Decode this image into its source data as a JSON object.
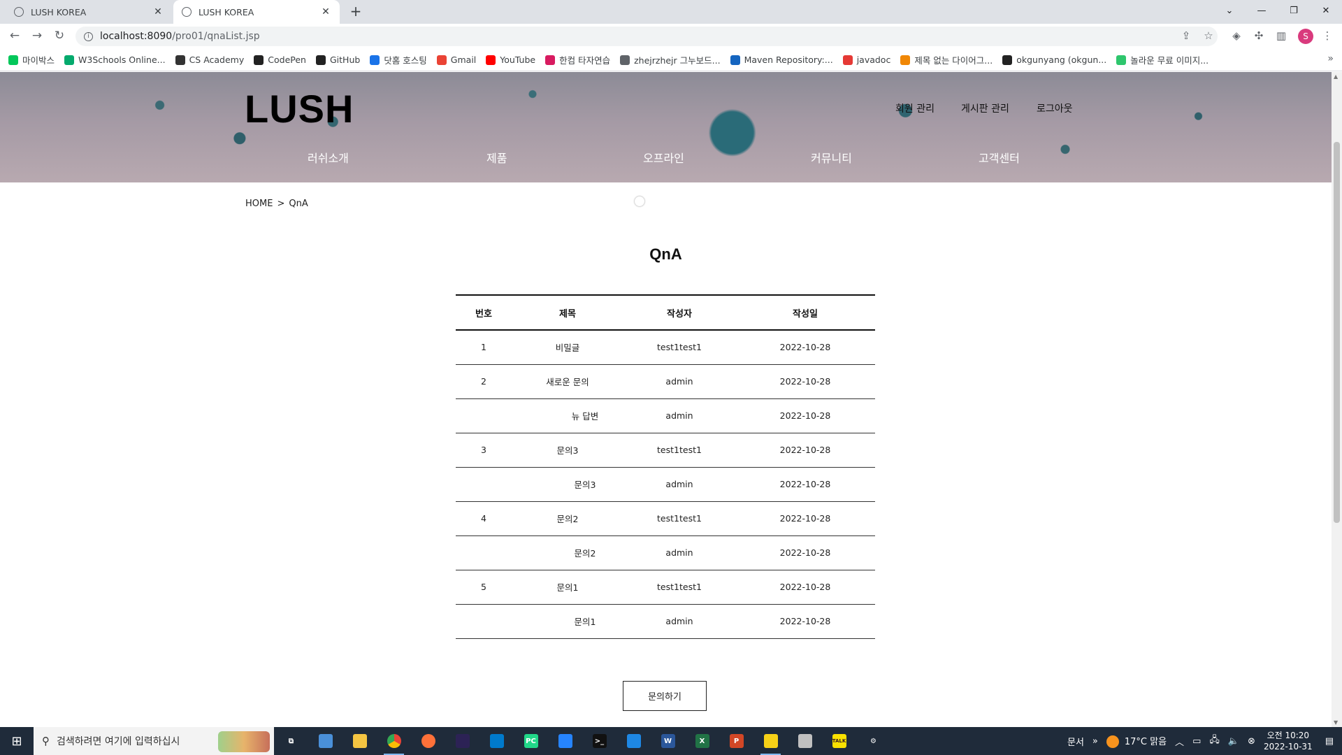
{
  "browser": {
    "tabs": [
      {
        "title": "LUSH KOREA",
        "active": false
      },
      {
        "title": "LUSH KOREA",
        "active": true
      }
    ],
    "url_host": "localhost:8090",
    "url_path": "/pro01/qnaList.jsp",
    "bookmarks": [
      {
        "label": "마이박스",
        "icon": "naver-icon",
        "color": "#03c75a"
      },
      {
        "label": "W3Schools Online...",
        "icon": "w3schools-icon",
        "color": "#04aa6d"
      },
      {
        "label": "CS Academy",
        "icon": "cs-academy-icon",
        "color": "#333333"
      },
      {
        "label": "CodePen",
        "icon": "codepen-icon",
        "color": "#222222"
      },
      {
        "label": "GitHub",
        "icon": "github-icon",
        "color": "#222222"
      },
      {
        "label": "닷홈 호스팅",
        "icon": "dothome-icon",
        "color": "#1a73e8"
      },
      {
        "label": "Gmail",
        "icon": "gmail-icon",
        "color": "#ea4335"
      },
      {
        "label": "YouTube",
        "icon": "youtube-icon",
        "color": "#ff0000"
      },
      {
        "label": "한컴 타자연습",
        "icon": "hancom-icon",
        "color": "#d81b60"
      },
      {
        "label": "zhejrzhejr 그누보드...",
        "icon": "globe-icon",
        "color": "#5f6368"
      },
      {
        "label": "Maven Repository:...",
        "icon": "maven-icon",
        "color": "#1565c0"
      },
      {
        "label": "javadoc",
        "icon": "oracle-icon",
        "color": "#e53935"
      },
      {
        "label": "제목 없는 다이어그...",
        "icon": "drawio-icon",
        "color": "#f08705"
      },
      {
        "label": "okgunyang (okgun...",
        "icon": "github-icon",
        "color": "#222222"
      },
      {
        "label": "놀라운 무료 이미지...",
        "icon": "pixabay-icon",
        "color": "#2ec66d"
      }
    ]
  },
  "site": {
    "logo": "LUSH",
    "util_links": [
      "회원 관리",
      "게시판 관리",
      "로그아웃"
    ],
    "gnb": [
      "러쉬소개",
      "제품",
      "오프라인",
      "커뮤니티",
      "고객센터"
    ]
  },
  "breadcrumb": {
    "home": "HOME",
    "sep": ">",
    "current": "QnA"
  },
  "board": {
    "title": "QnA",
    "columns": [
      "번호",
      "제목",
      "작성자",
      "작성일"
    ],
    "rows": [
      {
        "no": "1",
        "title": "비밀글",
        "author": "test1test1",
        "date": "2022-10-28",
        "reply": false
      },
      {
        "no": "2",
        "title": "새로운 문의",
        "author": "admin",
        "date": "2022-10-28",
        "reply": false
      },
      {
        "no": "",
        "title": "뉴 답변",
        "author": "admin",
        "date": "2022-10-28",
        "reply": true
      },
      {
        "no": "3",
        "title": "문의3",
        "author": "test1test1",
        "date": "2022-10-28",
        "reply": false
      },
      {
        "no": "",
        "title": "문의3",
        "author": "admin",
        "date": "2022-10-28",
        "reply": true
      },
      {
        "no": "4",
        "title": "문의2",
        "author": "test1test1",
        "date": "2022-10-28",
        "reply": false
      },
      {
        "no": "",
        "title": "문의2",
        "author": "admin",
        "date": "2022-10-28",
        "reply": true
      },
      {
        "no": "5",
        "title": "문의1",
        "author": "test1test1",
        "date": "2022-10-28",
        "reply": false
      },
      {
        "no": "",
        "title": "문의1",
        "author": "admin",
        "date": "2022-10-28",
        "reply": true
      }
    ],
    "ask_button": "문의하기"
  },
  "taskbar": {
    "search_placeholder": "검색하려면 여기에 입력하십시",
    "apps": [
      {
        "name": "task-view-icon",
        "glyph": "⧉",
        "color": "transparent"
      },
      {
        "name": "app-icon",
        "glyph": "",
        "color": "#4a90d9"
      },
      {
        "name": "file-explorer-icon",
        "glyph": "",
        "color": "#f5c542"
      },
      {
        "name": "chrome-icon",
        "glyph": "",
        "color": "#34a853"
      },
      {
        "name": "firefox-icon",
        "glyph": "",
        "color": "#ff7139"
      },
      {
        "name": "eclipse-icon",
        "glyph": "",
        "color": "#2c2255"
      },
      {
        "name": "vscode-icon",
        "glyph": "",
        "color": "#007acc"
      },
      {
        "name": "pycharm-icon",
        "glyph": "PC",
        "color": "#21d789"
      },
      {
        "name": "sourcetree-icon",
        "glyph": "",
        "color": "#2684ff"
      },
      {
        "name": "terminal-icon",
        "glyph": ">_",
        "color": "#111111"
      },
      {
        "name": "app2-icon",
        "glyph": "",
        "color": "#1e88e5"
      },
      {
        "name": "word-icon",
        "glyph": "W",
        "color": "#2b579a"
      },
      {
        "name": "excel-icon",
        "glyph": "X",
        "color": "#217346"
      },
      {
        "name": "powerpoint-icon",
        "glyph": "P",
        "color": "#d24726"
      },
      {
        "name": "sticky-notes-icon",
        "glyph": "",
        "color": "#f7d117"
      },
      {
        "name": "cloud-icon",
        "glyph": "",
        "color": "#c0c0c0"
      },
      {
        "name": "kakaotalk-icon",
        "glyph": "TALK",
        "color": "#fae100"
      },
      {
        "name": "settings-icon",
        "glyph": "⚙",
        "color": "transparent"
      }
    ],
    "tray_label": "문서",
    "weather": "17°C  맑음",
    "time": "오전 10:20",
    "date": "2022-10-31"
  }
}
